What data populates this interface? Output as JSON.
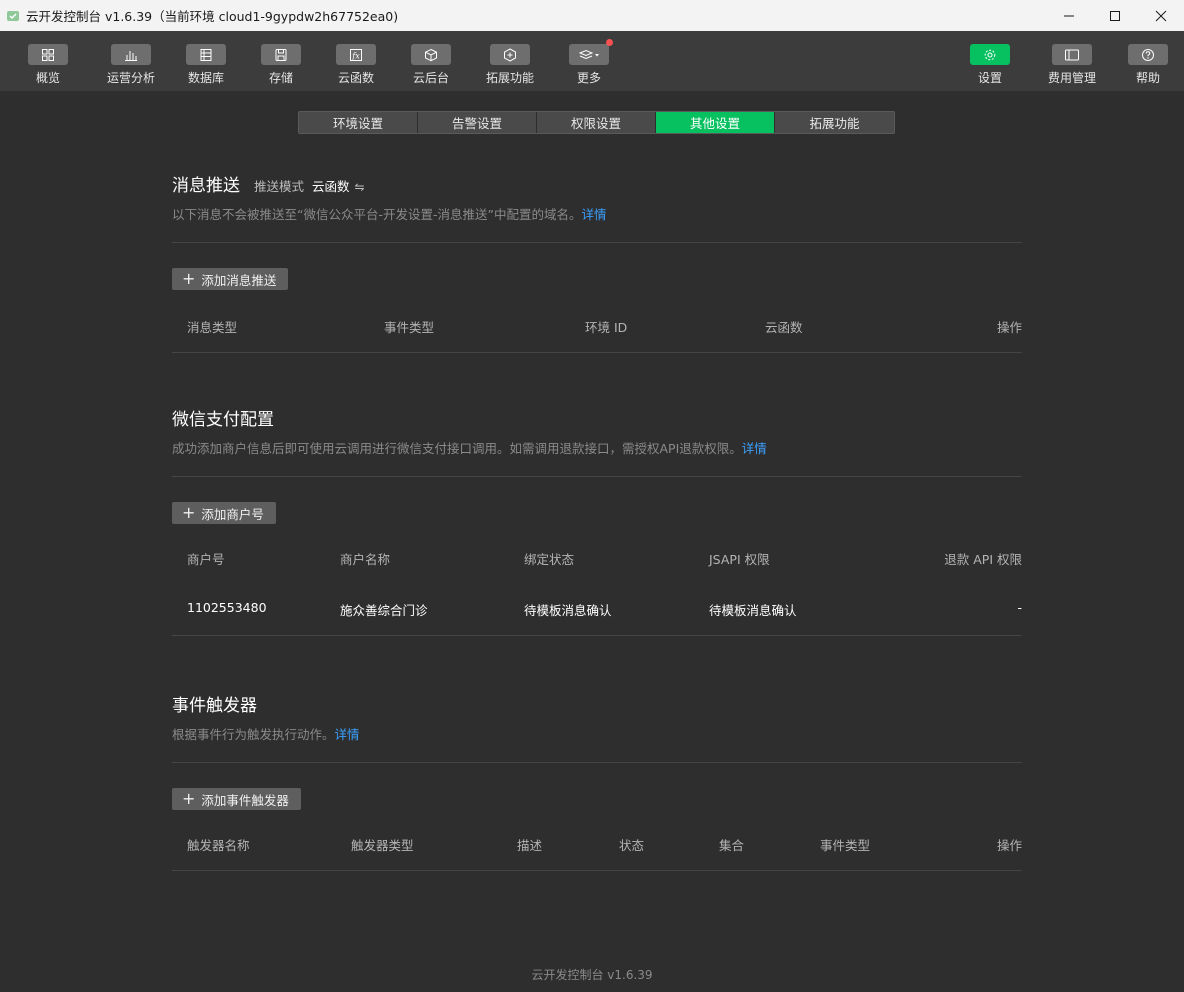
{
  "window": {
    "title": "云开发控制台 v1.6.39（当前环境 cloud1-9gypdw2h67752ea0)"
  },
  "toolbar": {
    "left": [
      {
        "label": "概览",
        "icon": "grid-icon"
      },
      {
        "label": "运营分析",
        "icon": "bar-chart-icon"
      },
      {
        "label": "数据库",
        "icon": "database-icon"
      },
      {
        "label": "存储",
        "icon": "storage-icon"
      },
      {
        "label": "云函数",
        "icon": "function-icon"
      },
      {
        "label": "云后台",
        "icon": "cube-icon"
      },
      {
        "label": "拓展功能",
        "icon": "extension-icon"
      },
      {
        "label": "更多",
        "icon": "layers-icon"
      }
    ],
    "right": [
      {
        "label": "设置",
        "icon": "gear-icon"
      },
      {
        "label": "费用管理",
        "icon": "billing-icon"
      },
      {
        "label": "帮助",
        "icon": "help-icon"
      }
    ]
  },
  "tabs": [
    "环境设置",
    "告警设置",
    "权限设置",
    "其他设置",
    "拓展功能"
  ],
  "active_tab": "其他设置",
  "push": {
    "title": "消息推送",
    "mode_label": "推送模式",
    "mode_value": "云函数",
    "switch_glyph": "⇋",
    "desc": "以下消息不会被推送至“微信公众平台-开发设置-消息推送”中配置的域名。",
    "link": "详情",
    "add_button": "添加消息推送",
    "columns": [
      "消息类型",
      "事件类型",
      "环境 ID",
      "云函数",
      "操作"
    ]
  },
  "pay": {
    "title": "微信支付配置",
    "desc": "成功添加商户信息后即可使用云调用进行微信支付接口调用。如需调用退款接口，需授权API退款权限。",
    "link": "详情",
    "add_button": "添加商户号",
    "columns": [
      "商户号",
      "商户名称",
      "绑定状态",
      "JSAPI 权限",
      "退款 API 权限"
    ],
    "rows": [
      [
        "1102553480",
        "施众善综合门诊",
        "待模板消息确认",
        "待模板消息确认",
        "-"
      ]
    ]
  },
  "trigger": {
    "title": "事件触发器",
    "desc": "根据事件行为触发执行动作。",
    "link": "详情",
    "add_button": "添加事件触发器",
    "columns": [
      "触发器名称",
      "触发器类型",
      "描述",
      "状态",
      "集合",
      "事件类型",
      "操作"
    ]
  },
  "footer": "云开发控制台 v1.6.39",
  "colors": {
    "accent": "#07c160",
    "link": "#3ba0ff",
    "background": "#2e2e2e",
    "toolbar": "#3c3c3c",
    "badge": "#fa5151"
  }
}
